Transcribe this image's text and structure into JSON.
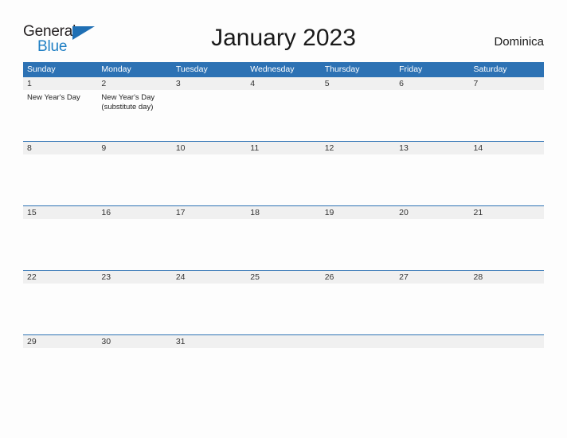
{
  "brand": {
    "line1": "General",
    "line2": "Blue",
    "triangle_color": "#1f6fb4",
    "blue_color": "#1f7fc4"
  },
  "header": {
    "title": "January 2023",
    "country": "Dominica"
  },
  "theme": {
    "header_blue": "#2d72b4",
    "day_number_bg": "#f0f0f0",
    "page_bg": "#fdfdfd"
  },
  "weekdays": [
    "Sunday",
    "Monday",
    "Tuesday",
    "Wednesday",
    "Thursday",
    "Friday",
    "Saturday"
  ],
  "weeks": [
    [
      {
        "date": "1",
        "events": [
          "New Year's Day"
        ]
      },
      {
        "date": "2",
        "events": [
          "New Year's Day (substitute day)"
        ]
      },
      {
        "date": "3",
        "events": []
      },
      {
        "date": "4",
        "events": []
      },
      {
        "date": "5",
        "events": []
      },
      {
        "date": "6",
        "events": []
      },
      {
        "date": "7",
        "events": []
      }
    ],
    [
      {
        "date": "8",
        "events": []
      },
      {
        "date": "9",
        "events": []
      },
      {
        "date": "10",
        "events": []
      },
      {
        "date": "11",
        "events": []
      },
      {
        "date": "12",
        "events": []
      },
      {
        "date": "13",
        "events": []
      },
      {
        "date": "14",
        "events": []
      }
    ],
    [
      {
        "date": "15",
        "events": []
      },
      {
        "date": "16",
        "events": []
      },
      {
        "date": "17",
        "events": []
      },
      {
        "date": "18",
        "events": []
      },
      {
        "date": "19",
        "events": []
      },
      {
        "date": "20",
        "events": []
      },
      {
        "date": "21",
        "events": []
      }
    ],
    [
      {
        "date": "22",
        "events": []
      },
      {
        "date": "23",
        "events": []
      },
      {
        "date": "24",
        "events": []
      },
      {
        "date": "25",
        "events": []
      },
      {
        "date": "26",
        "events": []
      },
      {
        "date": "27",
        "events": []
      },
      {
        "date": "28",
        "events": []
      }
    ],
    [
      {
        "date": "29",
        "events": []
      },
      {
        "date": "30",
        "events": []
      },
      {
        "date": "31",
        "events": []
      },
      {
        "date": "",
        "events": []
      },
      {
        "date": "",
        "events": []
      },
      {
        "date": "",
        "events": []
      },
      {
        "date": "",
        "events": []
      }
    ]
  ]
}
